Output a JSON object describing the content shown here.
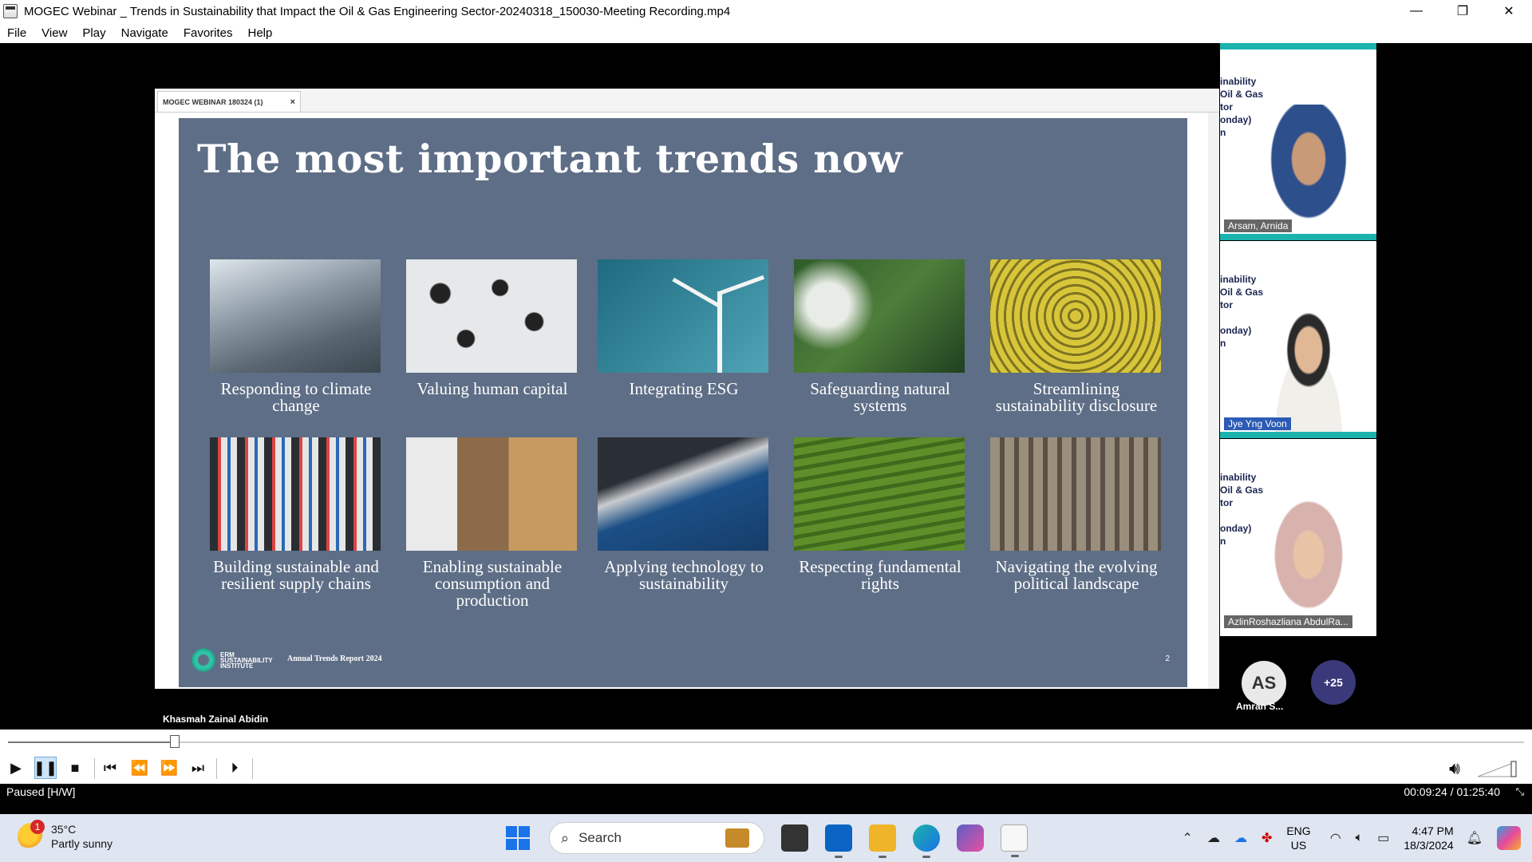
{
  "window": {
    "title": "MOGEC Webinar _ Trends in Sustainability that Impact the Oil & Gas Engineering Sector-20240318_150030-Meeting Recording.mp4",
    "minimize": "—",
    "restore": "❐",
    "close": "✕"
  },
  "menu": [
    "File",
    "View",
    "Play",
    "Navigate",
    "Favorites",
    "Help"
  ],
  "share": {
    "tab_label": "MOGEC WEBINAR 180324 (1)",
    "tab_close": "×"
  },
  "slide": {
    "title": "The most important trends now",
    "cards": [
      {
        "label": "Responding to climate change",
        "color": "#7d8c9a"
      },
      {
        "label": "Valuing human capital",
        "color": "#c9cdd2"
      },
      {
        "label": "Integrating ESG",
        "color": "#2a7a8e"
      },
      {
        "label": "Safeguarding natural systems",
        "color": "#3d6b37"
      },
      {
        "label": "Streamlining sustainability disclosure",
        "color": "#b9a42a"
      },
      {
        "label": "Building sustainable and resilient supply chains",
        "color": "#6b7a88"
      },
      {
        "label": "Enabling sustainable consumption and production",
        "color": "#8a6e52"
      },
      {
        "label": "Applying technology to sustainability",
        "color": "#1d4a78"
      },
      {
        "label": "Respecting fundamental rights",
        "color": "#5f8a2a"
      },
      {
        "label": "Navigating the evolving political landscape",
        "color": "#7a6e5e"
      }
    ],
    "logo_text": "ERM SUSTAINABILITY INSTITUTE",
    "report_label": "Annual Trends Report 2024",
    "page_number": "2"
  },
  "presenter_name": "Khasmah Zainal Abidin",
  "participants": [
    {
      "name": "Arsam, Arnida",
      "banner": "inability\nOil & Gas\ntor\nonday)\nn",
      "highlighted": false
    },
    {
      "name": "Jye Yng Voon",
      "banner": "inability\nOil & Gas\ntor\nonday)\nn",
      "highlighted": true
    },
    {
      "name": "AzlinRoshazliana AbdulRa...",
      "banner": "inability\nOil & Gas\ntor\nonday)\nn",
      "highlighted": false
    }
  ],
  "avatar": {
    "initials": "AS",
    "name": "Amran S..."
  },
  "more_participants": "+25",
  "player": {
    "progress": 0.11,
    "status": "Paused [H/W]",
    "time": "00:09:24 / 01:25:40"
  },
  "taskbar": {
    "temperature": "35°C",
    "weather": "Partly sunny",
    "weather_badge": "1",
    "search_placeholder": "Search",
    "lang_top": "ENG",
    "lang_bottom": "US",
    "time": "4:47 PM",
    "date": "18/3/2024"
  }
}
